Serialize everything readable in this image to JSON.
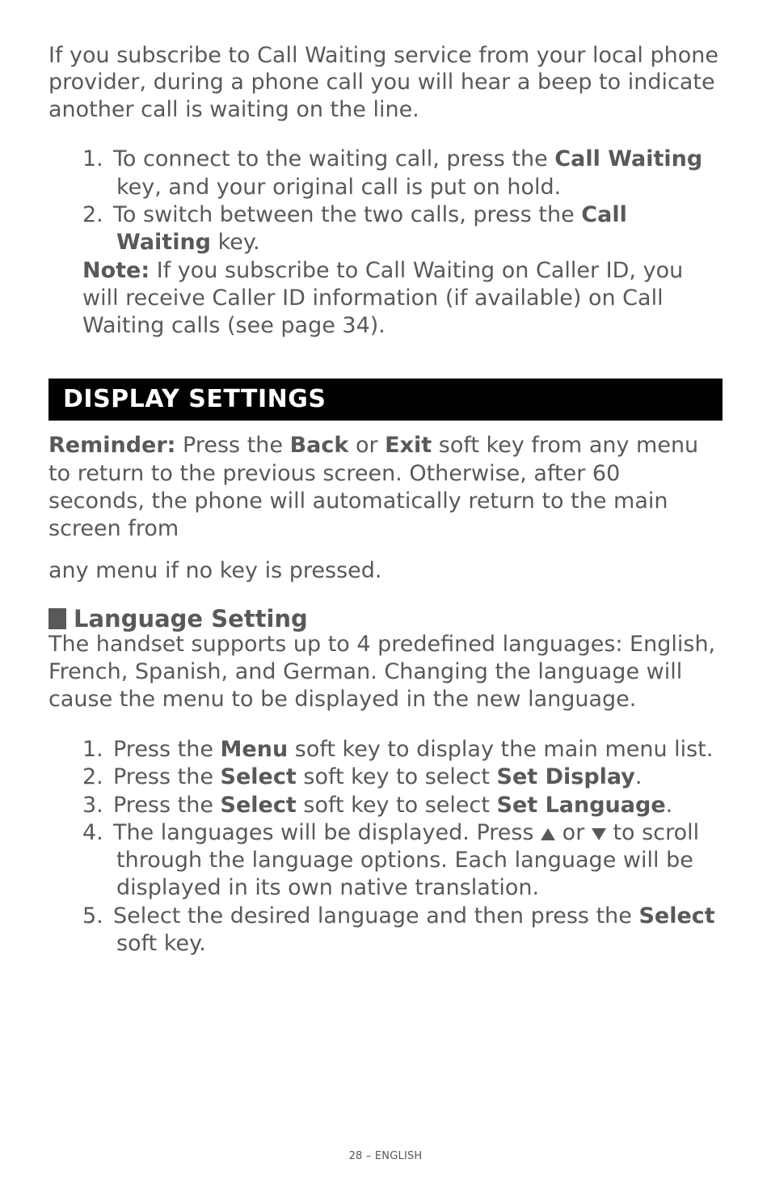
{
  "intro": "If you subscribe to Call Waiting service from your local phone provider, during a phone call you will hear a beep to indicate another call is waiting on the line.",
  "cw_steps": {
    "s1_pre": "To connect to the waiting call, press the ",
    "s1_key": "Call Waiting",
    "s1_post": " key, and your original call is put on hold.",
    "s2_pre": "To switch between the two calls, press the ",
    "s2_key": "Call Waiting",
    "s2_post": " key."
  },
  "note_label": "Note:",
  "note_text": " If you subscribe to Call Waiting on Caller ID, you will receive Caller ID information (if available) on Call Waiting calls (see page 34).",
  "section_title": "DISPLAY SETTINGS",
  "reminder_label": "Reminder:",
  "reminder_pre": " Press the ",
  "reminder_back": "Back",
  "reminder_or": " or ",
  "reminder_exit": "Exit",
  "reminder_mid": " soft key from any menu to return to the previous screen.  Otherwise, after 60 seconds, the phone will automatically return to the main screen from",
  "reminder_last": "any menu if no key is pressed.",
  "subhead": "Language Setting",
  "lang_body": "The handset supports up to 4 predefined languages: English, French, Spanish, and German.  Changing the language will cause the menu to be displayed in the new language.",
  "lang_steps": {
    "s1_pre": "Press the ",
    "s1_key": "Menu",
    "s1_post": " soft key to display the main menu list.",
    "s2_pre": "Press the ",
    "s2_key": "Select",
    "s2_mid": " soft key to select ",
    "s2_opt": "Set Display",
    "s2_post": ".",
    "s3_pre": "Press the ",
    "s3_key": "Select",
    "s3_mid": " soft key to select ",
    "s3_opt": "Set Language",
    "s3_post": ".",
    "s4_pre": "The languages will be displayed.  Press ",
    "s4_or": "  or ",
    "s4_post": "  to scroll through the language options.  Each language will be displayed in its own native translation.",
    "s5_pre": "Select the desired language and then press the ",
    "s5_key": "Select",
    "s5_post": " soft key."
  },
  "num": {
    "n1": "1.",
    "n2": "2.",
    "n3": "3.",
    "n4": "4.",
    "n5": "5."
  },
  "footer": "28 – ENGLISH"
}
